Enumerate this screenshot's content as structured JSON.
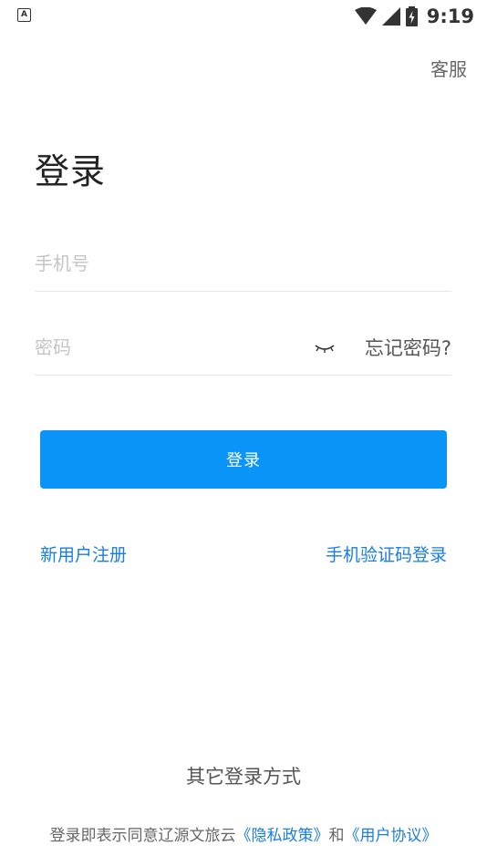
{
  "status_bar": {
    "notification_icon": "A",
    "time": "9:19"
  },
  "header": {
    "service_label": "客服"
  },
  "page_title": "登录",
  "form": {
    "phone_placeholder": "手机号",
    "phone_value": "",
    "password_placeholder": "密码",
    "password_value": "",
    "forgot_label": "忘记密码?",
    "login_label": "登录"
  },
  "links": {
    "register_label": "新用户注册",
    "sms_login_label": "手机验证码登录"
  },
  "other_login_label": "其它登录方式",
  "agreement": {
    "prefix": "登录即表示同意辽源文旅云",
    "privacy_label": "《隐私政策》",
    "conjunction": "和",
    "terms_label": "《用户协议》"
  },
  "colors": {
    "accent": "#0a94f7",
    "link": "#1a7de0"
  },
  "icons": [
    "notification-icon",
    "wifi-icon",
    "cellular-icon",
    "battery-icon",
    "eye-closed-icon"
  ]
}
